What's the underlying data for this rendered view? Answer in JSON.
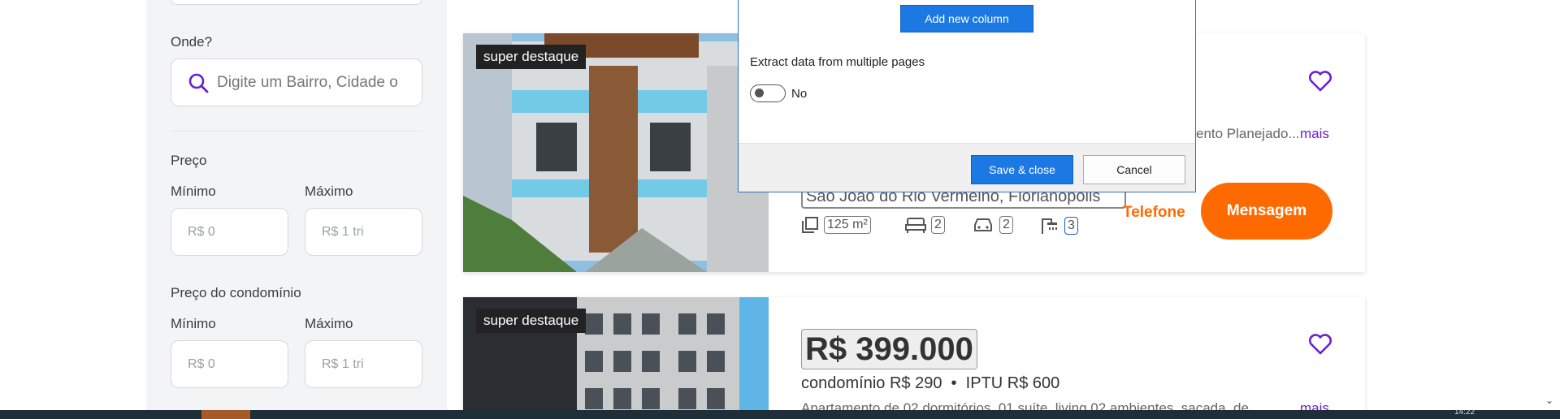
{
  "sidebar": {
    "where_label": "Onde?",
    "search_placeholder": "Digite um Bairro, Cidade o",
    "price_label": "Preço",
    "min_label": "Mínimo",
    "max_label": "Máximo",
    "min_placeholder": "R$ 0",
    "max_placeholder": "R$ 1 tri",
    "condo_label": "Preço do condomínio",
    "condo_min_label": "Mínimo",
    "condo_max_label": "Máximo",
    "condo_min_placeholder": "R$ 0",
    "condo_max_placeholder": "R$ 1 tri"
  },
  "listings": [
    {
      "badge": "super destaque",
      "description_tail": "ento Planejado...",
      "more": "mais",
      "address": "São João do Rio Vermelho, Florianópolis",
      "area": "125 m²",
      "bedrooms": "2",
      "parking": "2",
      "bathrooms": "3",
      "phone_label": "Telefone",
      "message_label": "Mensagem"
    },
    {
      "badge": "super destaque",
      "price": "R$ 399.000",
      "fees": "condomínio R$ 290  •  IPTU R$ 600",
      "description": "Apartamento de 02 dormitórios, 01 suíte, living 02 ambientes, sacada, de",
      "more": "mais"
    }
  ],
  "dialog": {
    "add_column_label": "Add new column",
    "extract_label": "Extract data from multiple pages",
    "toggle_label": "No",
    "save_label": "Save & close",
    "cancel_label": "Cancel"
  },
  "colors": {
    "accent_purple": "#6a1fd1",
    "accent_orange": "#ff6a00",
    "dialog_blue": "#1c79e4"
  },
  "taskbar": {
    "clock": "14:22"
  }
}
